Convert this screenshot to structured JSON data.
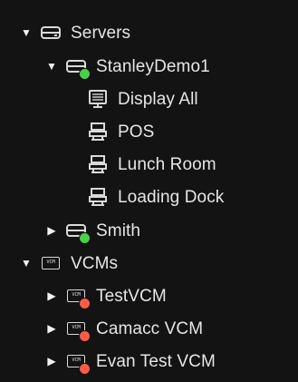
{
  "tree": {
    "servers": {
      "label": "Servers",
      "expanded_arrow": "▼",
      "icon": "server-icon",
      "children": [
        {
          "label": "StanleyDemo1",
          "arrow": "▼",
          "icon": "server-online-icon",
          "status": "online",
          "children": [
            {
              "label": "Display All",
              "icon": "display-wall-icon"
            },
            {
              "label": "POS",
              "icon": "pos-register-icon"
            },
            {
              "label": "Lunch Room",
              "icon": "pos-register-icon"
            },
            {
              "label": "Loading Dock",
              "icon": "pos-register-icon"
            }
          ]
        },
        {
          "label": "Smith",
          "arrow": "▶",
          "icon": "server-online-icon",
          "status": "online"
        }
      ]
    },
    "vcms": {
      "label": "VCMs",
      "expanded_arrow": "▼",
      "icon": "vcm-icon",
      "badge_text": "VCM",
      "children": [
        {
          "label": "TestVCM",
          "arrow": "▶",
          "icon": "vcm-offline-icon",
          "status": "offline"
        },
        {
          "label": "Camacc VCM",
          "arrow": "▶",
          "icon": "vcm-offline-icon",
          "status": "offline"
        },
        {
          "label": "Evan Test VCM",
          "arrow": "▶",
          "icon": "vcm-offline-icon",
          "status": "offline"
        }
      ]
    }
  },
  "colors": {
    "background": "#131313",
    "text": "#e6e6e6",
    "online": "#47d14a",
    "offline": "#ff5a45",
    "icon": "#d9d9d9"
  }
}
